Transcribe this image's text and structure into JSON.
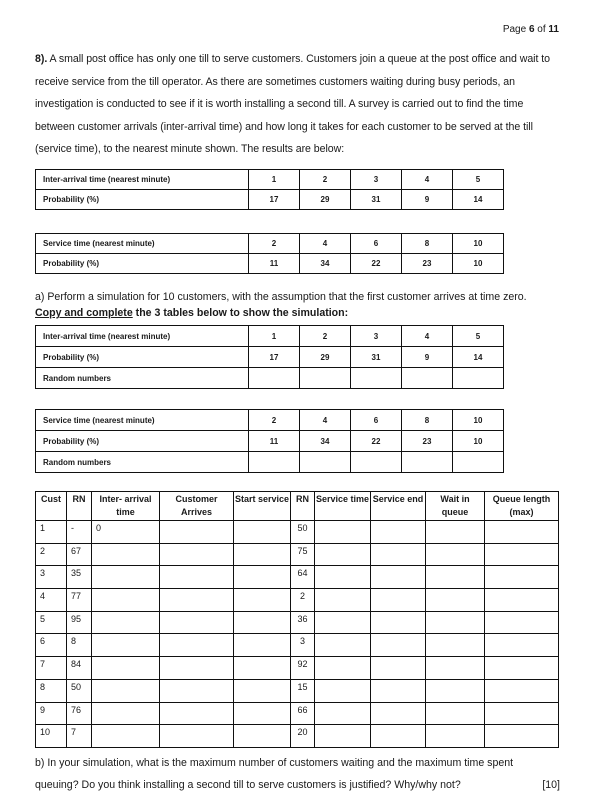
{
  "page": {
    "label_prefix": "Page",
    "current": "6",
    "of_label": "of",
    "total": "11"
  },
  "question": {
    "number": "8).",
    "intro": "A small post office has only one till to serve customers. Customers join a queue at the post office and wait to receive service from the till operator. As there are sometimes customers waiting during busy periods, an investigation is conducted to see if it is worth installing a second till.  A survey is carried out to find the time between customer arrivals (inter-arrival time) and how long it takes for each customer to be served at the till (service time), to the nearest minute shown.  The results are below:"
  },
  "interarrival_table": {
    "header_label": "Inter-arrival time (nearest minute)",
    "values": [
      "1",
      "2",
      "3",
      "4",
      "5"
    ],
    "prob_label": "Probability (%)",
    "probabilities": [
      "17",
      "29",
      "31",
      "9",
      "14"
    ]
  },
  "service_table": {
    "header_label": "Service time (nearest minute)",
    "values": [
      "2",
      "4",
      "6",
      "8",
      "10"
    ],
    "prob_label": "Probability (%)",
    "probabilities": [
      "11",
      "34",
      "22",
      "23",
      "10"
    ]
  },
  "part_a": {
    "text": "a) Perform a simulation for 10 customers, with the assumption that the first customer arrives at time zero.",
    "instruction_underlined": "Copy and complete",
    "instruction_rest": " the 3 tables below to show the simulation:"
  },
  "interarrival_table_rn": {
    "header_label": "Inter-arrival time (nearest minute)",
    "values": [
      "1",
      "2",
      "3",
      "4",
      "5"
    ],
    "prob_label": "Probability (%)",
    "probabilities": [
      "17",
      "29",
      "31",
      "9",
      "14"
    ],
    "rn_label": "Random numbers"
  },
  "service_table_rn": {
    "header_label": "Service time (nearest minute)",
    "values": [
      "2",
      "4",
      "6",
      "8",
      "10"
    ],
    "prob_label": "Probability (%)",
    "probabilities": [
      "11",
      "34",
      "22",
      "23",
      "10"
    ],
    "rn_label": "Random numbers"
  },
  "simulation_table": {
    "headers": [
      "Cust",
      "RN",
      "Inter- arrival time",
      "Customer Arrives",
      "Start service",
      "RN",
      "Service time",
      "Service end",
      "Wait in queue",
      "Queue length (max)"
    ],
    "rows": [
      {
        "cust": "1",
        "rn1": "-",
        "inter": "0",
        "rn2": "50"
      },
      {
        "cust": "2",
        "rn1": "67",
        "inter": "",
        "rn2": "75"
      },
      {
        "cust": "3",
        "rn1": "35",
        "inter": "",
        "rn2": "64"
      },
      {
        "cust": "4",
        "rn1": "77",
        "inter": "",
        "rn2": "2"
      },
      {
        "cust": "5",
        "rn1": "95",
        "inter": "",
        "rn2": "36"
      },
      {
        "cust": "6",
        "rn1": "8",
        "inter": "",
        "rn2": "3"
      },
      {
        "cust": "7",
        "rn1": "84",
        "inter": "",
        "rn2": "92"
      },
      {
        "cust": "8",
        "rn1": "50",
        "inter": "",
        "rn2": "15"
      },
      {
        "cust": "9",
        "rn1": "76",
        "inter": "",
        "rn2": "66"
      },
      {
        "cust": "10",
        "rn1": "7",
        "inter": "",
        "rn2": "20"
      }
    ]
  },
  "part_b": {
    "line1": "b) In your simulation, what is the maximum number of customers waiting and the maximum time spent",
    "line2": "queuing?  Do you think installing a second till to serve customers is justified?   Why/why not?",
    "marks": "[10]"
  }
}
